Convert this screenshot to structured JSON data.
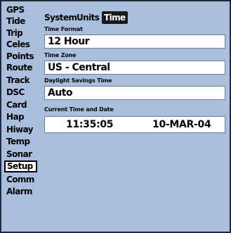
{
  "sidebar": {
    "items": [
      {
        "label": "GPS",
        "selected": false
      },
      {
        "label": "Tide",
        "selected": false
      },
      {
        "label": "Trip",
        "selected": false
      },
      {
        "label": "Celes",
        "selected": false
      },
      {
        "label": "Points",
        "selected": false
      },
      {
        "label": "Route",
        "selected": false
      },
      {
        "label": "Track",
        "selected": false
      },
      {
        "label": "DSC",
        "selected": false
      },
      {
        "label": "Card",
        "selected": false
      },
      {
        "label": "Hap",
        "selected": false
      },
      {
        "label": "Hiway",
        "selected": false
      },
      {
        "label": "Temp",
        "selected": false
      },
      {
        "label": "Sonar",
        "selected": false
      },
      {
        "label": "Setup",
        "selected": true
      },
      {
        "label": "Comm",
        "selected": false
      },
      {
        "label": "Alarm",
        "selected": false
      }
    ]
  },
  "tabs": {
    "system": "System",
    "units": "Units",
    "time": "Time",
    "active": "Time"
  },
  "time_format": {
    "label": "Time Format",
    "value": "12 Hour"
  },
  "time_zone": {
    "label": "Time Zone",
    "value": "US - Central"
  },
  "daylight_savings": {
    "label": "Daylight Savings Time",
    "value": "Auto"
  },
  "current_time": {
    "label": "Current Time and Date",
    "time": "11:35:05",
    "date": "10-MAR-04"
  },
  "colors": {
    "background": "#a9bfdd",
    "field": "#ffffff",
    "active_tab": "#1a1a1a"
  }
}
